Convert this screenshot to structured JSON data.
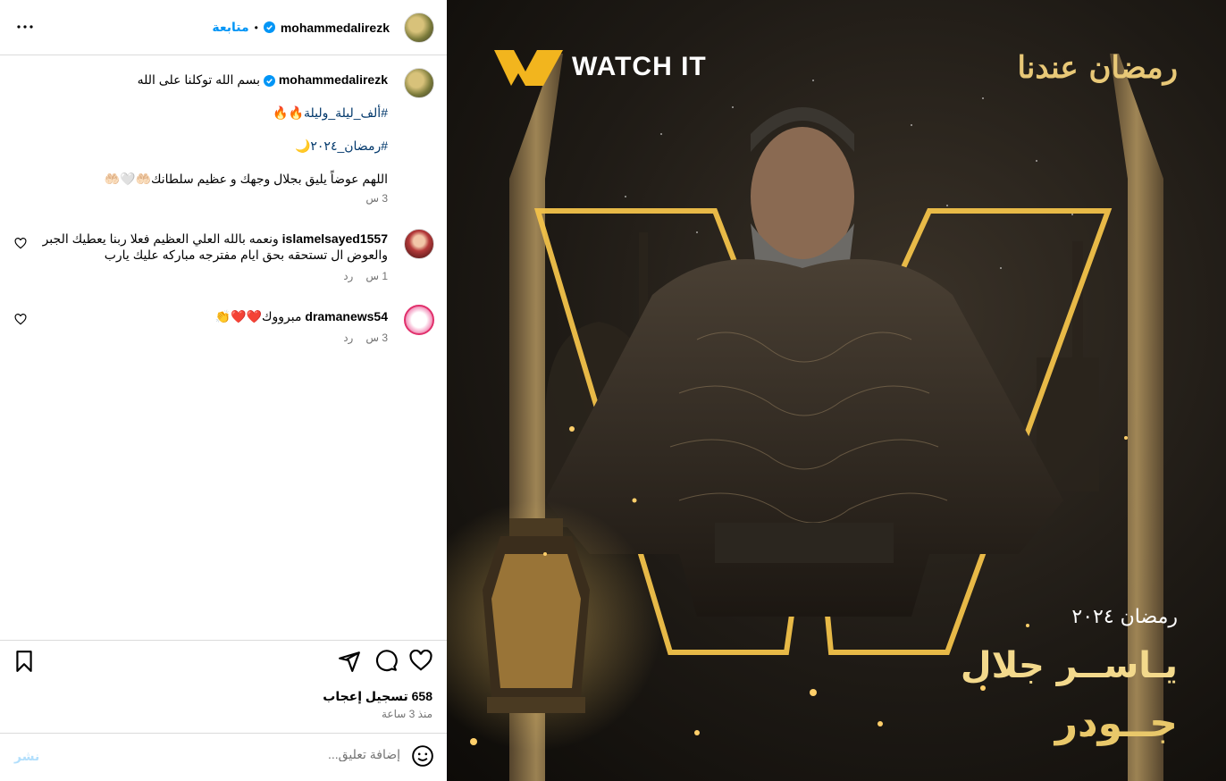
{
  "post": {
    "username": "mohammedalirezk",
    "follow_label": "متابعة",
    "separator": "•"
  },
  "caption": {
    "username": "mohammedalirezk",
    "text": "بسم الله توكلنا على الله",
    "hashtag1": "#ألف_ليلة_وليلة🔥🔥",
    "hashtag2": "#رمضان_٢٠٢٤🌙",
    "prayer": "اللهم عوضاً يليق بجلال وجهك و عظيم سلطانك🤲🏻🤍🤲🏻",
    "time": "3 س"
  },
  "comments": [
    {
      "username": "islamelsayed1557",
      "text": "ونعمه بالله العلي العظيم فعلا ربنا يعطيك الجبر والعوض ال تستحقه بحق ايام مفترجه مباركه عليك يارب",
      "time": "1 س",
      "reply": "رد"
    },
    {
      "username": "dramanews54",
      "text": "مبرووك❤️❤️👏",
      "time": "3 س",
      "reply": "رد"
    }
  ],
  "stats": {
    "likes": "658 تسجيل إعجاب",
    "posted": "منذ 3 ساعة"
  },
  "comment_box": {
    "placeholder": "إضافة تعليق...",
    "publish": "نشر"
  },
  "poster": {
    "brand": "WATCH IT",
    "ramadan_logo": "رمضان عندنا",
    "ramadan": "رمضان ٢٠٢٤",
    "actor": "يـاســر جلال",
    "series": "جــودر"
  }
}
